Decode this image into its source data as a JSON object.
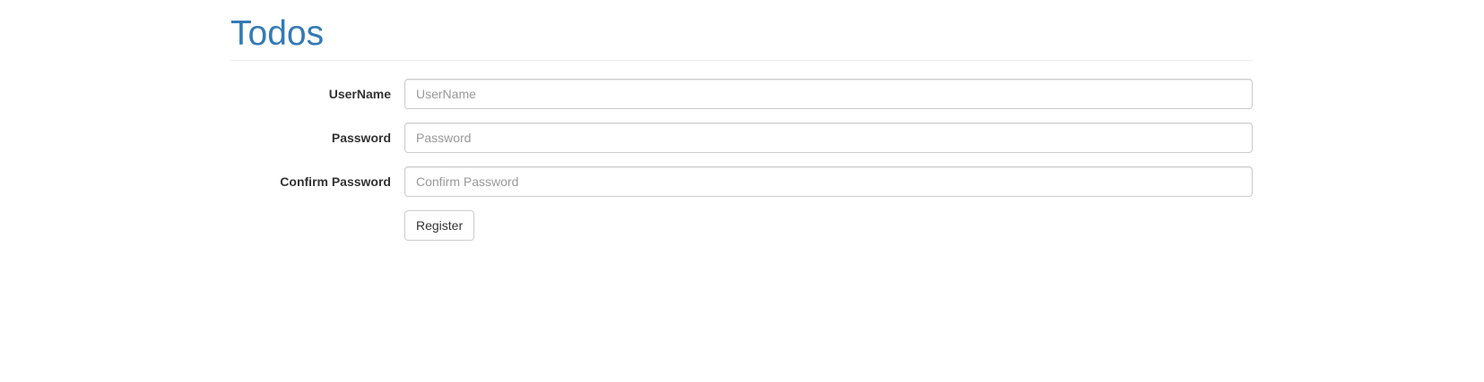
{
  "header": {
    "title": "Todos"
  },
  "form": {
    "username": {
      "label": "UserName",
      "placeholder": "UserName",
      "value": ""
    },
    "password": {
      "label": "Password",
      "placeholder": "Password",
      "value": ""
    },
    "confirm_password": {
      "label": "Confirm Password",
      "placeholder": "Confirm Password",
      "value": ""
    },
    "submit_label": "Register"
  },
  "colors": {
    "title": "#337ab7",
    "label": "#333333",
    "input_border": "#cccccc",
    "placeholder": "#999999",
    "divider": "#eeeeee"
  }
}
